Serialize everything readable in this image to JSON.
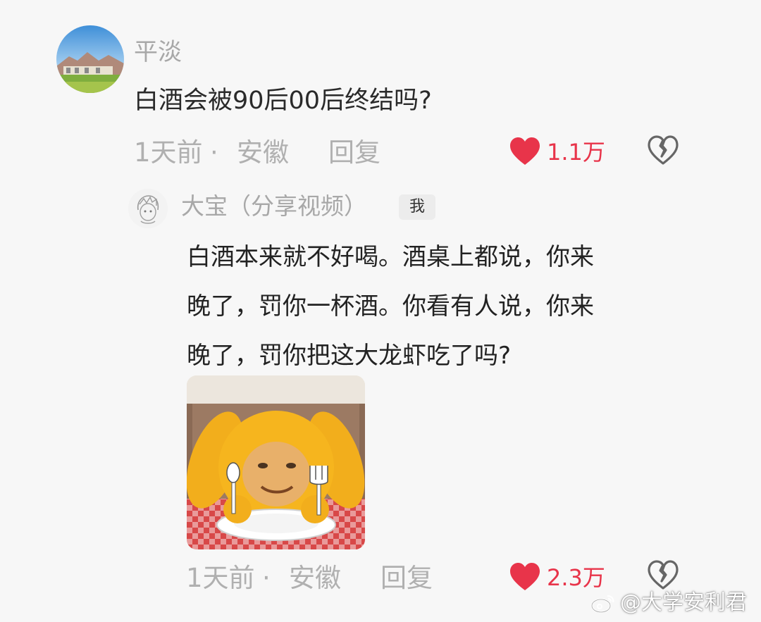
{
  "comment": {
    "username": "平淡",
    "text": "白酒会被90后00后终结吗?",
    "time": "1天前",
    "separator": "·",
    "location": "安徽",
    "reply_label": "回复",
    "likes": "1.1万"
  },
  "reply": {
    "username": "大宝（分享视频）",
    "badge": "我",
    "lines": [
      "白酒本来就不好喝。酒桌上都说，你来",
      "晚了，罚你一杯酒。你看有人说，你来",
      "晚了，罚你把这大龙虾吃了吗?"
    ],
    "time": "1天前",
    "separator": "·",
    "location": "安徽",
    "reply_label": "回复",
    "likes": "2.3万"
  },
  "watermark": {
    "text": "@大学安利君"
  },
  "colors": {
    "like": "#e8344a",
    "meta": "#b0b0b0",
    "background": "#f7f7f7"
  },
  "icons": {
    "like": "heart-icon",
    "dislike": "broken-heart-icon",
    "watermark": "weibo-logo-icon"
  }
}
